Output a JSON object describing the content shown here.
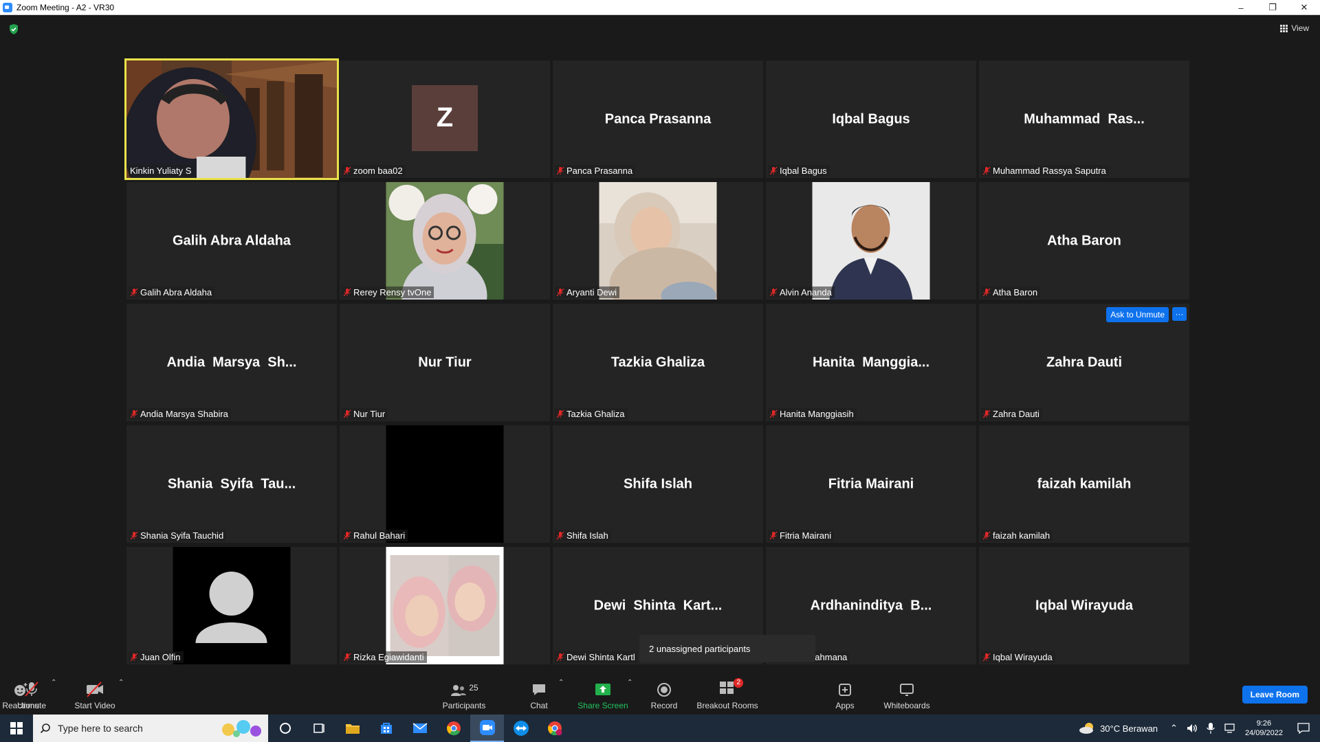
{
  "window": {
    "title": "Zoom Meeting - A2 - VR30"
  },
  "view_label": "View",
  "tiles": [
    {
      "label": "Kinkin Yuliaty S",
      "type": "video-kinkin",
      "active": true,
      "muted": false
    },
    {
      "label": "zoom baa02",
      "type": "initial",
      "initial": "Z",
      "muted": true
    },
    {
      "label": "Panca Prasanna",
      "display": "Panca Prasanna",
      "type": "name",
      "muted": true
    },
    {
      "label": "Iqbal Bagus",
      "display": "Iqbal Bagus",
      "type": "name",
      "muted": true
    },
    {
      "label": "Muhammad Rassya Saputra",
      "display": "Muhammad  Ras...",
      "type": "name",
      "muted": true
    },
    {
      "label": "Galih Abra Aldaha",
      "display": "Galih Abra Aldaha",
      "type": "name",
      "muted": true
    },
    {
      "label": "Rerey Rensy tvOne",
      "type": "photo-rerey",
      "muted": true
    },
    {
      "label": "Aryanti Dewi",
      "type": "photo-aryanti",
      "muted": true
    },
    {
      "label": "Alvin Ananda",
      "type": "photo-alvin",
      "muted": true
    },
    {
      "label": "Atha Baron",
      "display": "Atha Baron",
      "type": "name",
      "muted": true
    },
    {
      "label": "Andia Marsya Shabira",
      "display": "Andia  Marsya  Sh...",
      "type": "name",
      "muted": true
    },
    {
      "label": "Nur Tiur",
      "display": "Nur Tiur",
      "type": "name",
      "muted": true
    },
    {
      "label": "Tazkia Ghaliza",
      "display": "Tazkia Ghaliza",
      "type": "name",
      "muted": true
    },
    {
      "label": "Hanita Manggiasih",
      "display": "Hanita  Manggia...",
      "type": "name",
      "muted": true
    },
    {
      "label": "Zahra Dauti",
      "display": "Zahra Dauti",
      "type": "name",
      "muted": true,
      "hover": true
    },
    {
      "label": "Shania Syifa Tauchid",
      "display": "Shania  Syifa  Tau...",
      "type": "name",
      "muted": true
    },
    {
      "label": "Rahul Bahari",
      "type": "black",
      "muted": true
    },
    {
      "label": "Shifa Islah",
      "display": "Shifa Islah",
      "type": "name",
      "muted": true
    },
    {
      "label": "Fitria Mairani",
      "display": "Fitria Mairani",
      "type": "name",
      "muted": true
    },
    {
      "label": "faizah kamilah",
      "display": "faizah kamilah",
      "type": "name",
      "muted": true
    },
    {
      "label": "Juan Olfin",
      "type": "avatar",
      "muted": true
    },
    {
      "label": "Rizka Egiawidanti",
      "type": "photo-rizka",
      "muted": true
    },
    {
      "label": "Dewi Shinta Kartl",
      "display": "Dewi  Shinta  Kart...",
      "type": "name",
      "muted": true
    },
    {
      "label": "nditya Brahmana",
      "display": "Ardhaninditya  B...",
      "type": "name",
      "muted": true
    },
    {
      "label": "Iqbal Wirayuda",
      "display": "Iqbal Wirayuda",
      "type": "name",
      "muted": true
    }
  ],
  "hover_actions": {
    "ask_unmute": "Ask to Unmute",
    "more": "···"
  },
  "tooltip": "2 unassigned participants",
  "toolbar": {
    "unmute": "Unmute",
    "start_video": "Start Video",
    "participants": "Participants",
    "participants_count": "25",
    "chat": "Chat",
    "share_screen": "Share Screen",
    "record": "Record",
    "breakout_rooms": "Breakout Rooms",
    "breakout_badge": "2",
    "reactions": "Reactions",
    "apps": "Apps",
    "whiteboards": "Whiteboards",
    "leave": "Leave Room"
  },
  "taskbar": {
    "search_placeholder": "Type here to search",
    "weather": "30°C  Berawan",
    "time": "9:26",
    "date": "24/09/2022"
  },
  "colors": {
    "accent": "#0e72ed",
    "active_speaker": "#e9e24a",
    "share_green": "#22b14c",
    "muted_red": "#e02828"
  }
}
